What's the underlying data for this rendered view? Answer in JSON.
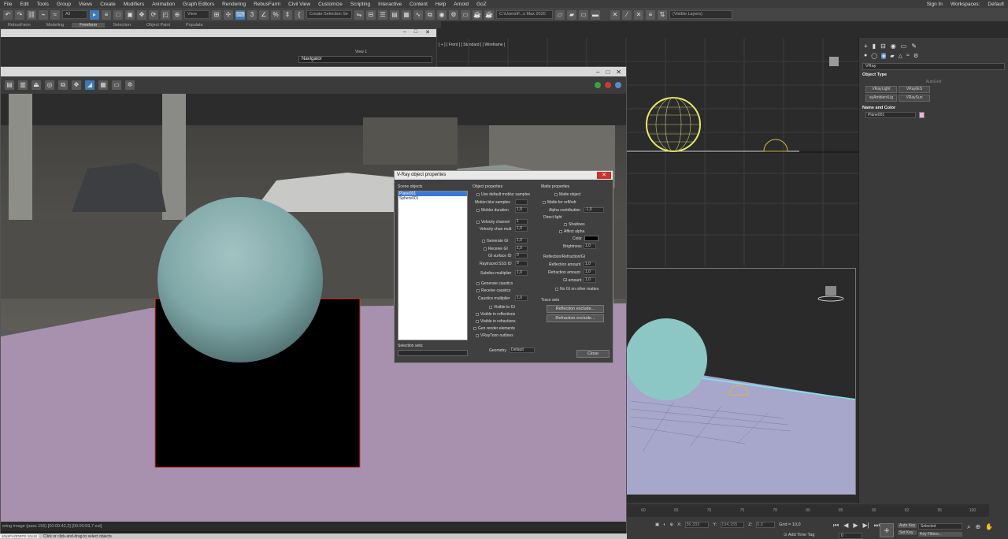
{
  "menu": [
    "File",
    "Edit",
    "Tools",
    "Group",
    "Views",
    "Create",
    "Modifiers",
    "Animation",
    "Graph Editors",
    "Rendering",
    "RebusFarm",
    "Civil View",
    "Customize",
    "Scripting",
    "Interactive",
    "Content",
    "Help",
    "Arnold",
    "GoZ"
  ],
  "toolbar": {
    "filter": "All",
    "view": "View",
    "selection_set": "Create Selection Se",
    "path": "C:\\Users\\F...s Max 2020",
    "layers": "(Visible Layers)"
  },
  "account": {
    "sign_in": "Sign In",
    "workspaces_label": "Workspaces:",
    "workspace": "Default"
  },
  "ribbon_tabs": [
    "RebusFarm",
    "Modeling",
    "Freeform",
    "Selection",
    "Object Paint",
    "Populate"
  ],
  "left_panel": {
    "view_label": "View 1",
    "navigator": "Navigator"
  },
  "viewport_front": {
    "label": "[ + ] [ Front ] [ Standard ] [ Wireframe ]"
  },
  "command_panel": {
    "dropdown": "VRay",
    "rollout_object_type": "Object Type",
    "autogrid": "AutoGrid",
    "buttons": [
      "VRayLight",
      "VRayIES",
      "ayAmbientLig",
      "VRaySun"
    ],
    "rollout_name_color": "Name and Color",
    "object_name": "Plane001",
    "object_color": "#e8b4e0"
  },
  "dialog": {
    "title": "V-Ray object properties",
    "scene_objects_label": "Scene objects",
    "scene_objects": [
      "Plane001",
      "Sphere001"
    ],
    "selection_sets_label": "Selection sets:",
    "object_properties": {
      "header": "Object properties",
      "use_default_moblur": "Use default moblur samples",
      "motion_blur_samples": "Motion blur samples",
      "moblur_duration": "Moblur duration",
      "moblur_duration_val": "1,0",
      "velocity_channel": "Velocity channel",
      "velocity_channel_val": "1",
      "velocity_chan_mult": "Velocity chan mult",
      "velocity_chan_mult_val": "1,0",
      "generate_gi": "Generate GI",
      "generate_gi_val": "1,0",
      "receive_gi": "Receive GI",
      "receive_gi_val": "1,0",
      "gi_surface_id": "GI surface ID",
      "gi_surface_id_val": "0",
      "raytraced_sss_id": "Raytraced SSS ID",
      "raytraced_sss_id_val": "0",
      "subdivs_multiplier": "Subdivs multiplier",
      "subdivs_multiplier_val": "1,0",
      "generate_caustics": "Generate caustics",
      "receive_caustics": "Receive caustics",
      "caustics_multiplier": "Caustics multiplier",
      "caustics_multiplier_val": "1,0",
      "visible_to_gi": "Visible to GI",
      "visible_in_reflections": "Visible in reflections",
      "visible_in_refractions": "Visible in refractions",
      "gen_render_elements": "Gen render elements",
      "vraytoon_outlines": "VRayToon outlines",
      "geometry_label": "Geometry",
      "geometry_val": "Default"
    },
    "matte_properties": {
      "header": "Matte properties",
      "matte_object": "Matte object",
      "matte_for_refl": "Matte for refl/refr",
      "alpha_contribution": "Alpha contribution",
      "alpha_contribution_val": "-1,0",
      "direct_light": "Direct light",
      "shadows": "Shadows",
      "affect_alpha": "Affect alpha",
      "color": "Color",
      "brightness": "Brightness",
      "brightness_val": "1,0",
      "refl_refr_gi": "Reflection/Refraction/GI",
      "reflection_amount": "Reflection amount",
      "reflection_amount_val": "1,0",
      "refraction_amount": "Refraction amount",
      "refraction_amount_val": "1,0",
      "gi_amount": "GI amount",
      "gi_amount_val": "1,0",
      "no_gi_on_other_mattes": "No GI on other mattes"
    },
    "trace_sets": {
      "header": "Trace sets",
      "reflection_exclude": "Reflection exclude...",
      "refraction_exclude": "Refraction exclude..."
    },
    "close": "Close"
  },
  "frame_status": "ering image (pass 156) [00:00:42,3] [00:00:59,7 est]",
  "status_bar": {
    "prefix": "10xSFAODEPS  10x10",
    "hint": "Click or click-and-drag to select objects"
  },
  "timeline_ticks": [
    "60",
    "65",
    "70",
    "75",
    "78",
    "80",
    "85",
    "90",
    "92",
    "95",
    "100"
  ],
  "coords": {
    "x_label": "X:",
    "x_val": "36,333",
    "y_label": "Y:",
    "y_val": "134,155",
    "z_label": "Z:",
    "z_val": "0,0",
    "grid": "Grid = 10,0"
  },
  "anim": {
    "auto_key": "Auto Key",
    "set_key": "Set Key",
    "selected": "Selected",
    "key_filters": "Key Filters...",
    "add_time_tag": "Add Time Tag",
    "frame": "0"
  }
}
